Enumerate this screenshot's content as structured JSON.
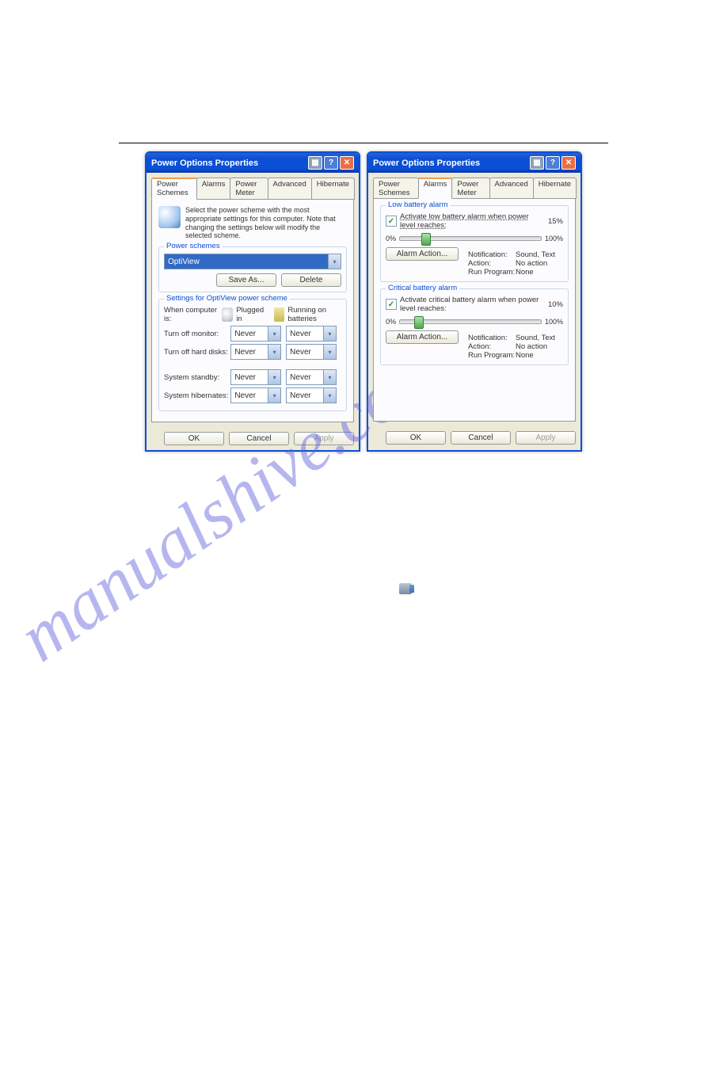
{
  "watermark": "manualshive.com",
  "dialog1": {
    "title": "Power Options Properties",
    "tabs": [
      "Power Schemes",
      "Alarms",
      "Power Meter",
      "Advanced",
      "Hibernate"
    ],
    "active_tab": 0,
    "intro": "Select the power scheme with the most appropriate settings for this computer. Note that changing the settings below will modify the selected scheme.",
    "group_schemes": {
      "title": "Power schemes",
      "selected": "OptiView",
      "save_as": "Save As...",
      "delete": "Delete"
    },
    "group_settings": {
      "title": "Settings for OptiView power scheme",
      "header_label": "When computer is:",
      "plugged": "Plugged in",
      "running": "Running on batteries",
      "rows": [
        {
          "label": "Turn off monitor:",
          "plugged": "Never",
          "batt": "Never"
        },
        {
          "label": "Turn off hard disks:",
          "plugged": "Never",
          "batt": "Never"
        },
        {
          "label": "System standby:",
          "plugged": "Never",
          "batt": "Never"
        },
        {
          "label": "System hibernates:",
          "plugged": "Never",
          "batt": "Never"
        }
      ]
    },
    "footer": {
      "ok": "OK",
      "cancel": "Cancel",
      "apply": "Apply"
    }
  },
  "dialog2": {
    "title": "Power Options Properties",
    "tabs": [
      "Power Schemes",
      "Alarms",
      "Power Meter",
      "Advanced",
      "Hibernate"
    ],
    "active_tab": 1,
    "low": {
      "title": "Low battery alarm",
      "check": "Activate low battery alarm when power level reaches:",
      "percent": "15%",
      "min": "0%",
      "max": "100%",
      "thumb_pct": 15,
      "action_btn": "Alarm Action...",
      "info": [
        {
          "k": "Notification:",
          "v": "Sound, Text"
        },
        {
          "k": "Action:",
          "v": "No action"
        },
        {
          "k": "Run Program:",
          "v": "None"
        }
      ]
    },
    "critical": {
      "title": "Critical battery alarm",
      "check": "Activate critical battery alarm when power level reaches:",
      "percent": "10%",
      "min": "0%",
      "max": "100%",
      "thumb_pct": 10,
      "action_btn": "Alarm Action...",
      "info": [
        {
          "k": "Notification:",
          "v": "Sound, Text"
        },
        {
          "k": "Action:",
          "v": "No action"
        },
        {
          "k": "Run Program:",
          "v": "None"
        }
      ]
    },
    "footer": {
      "ok": "OK",
      "cancel": "Cancel",
      "apply": "Apply"
    }
  }
}
